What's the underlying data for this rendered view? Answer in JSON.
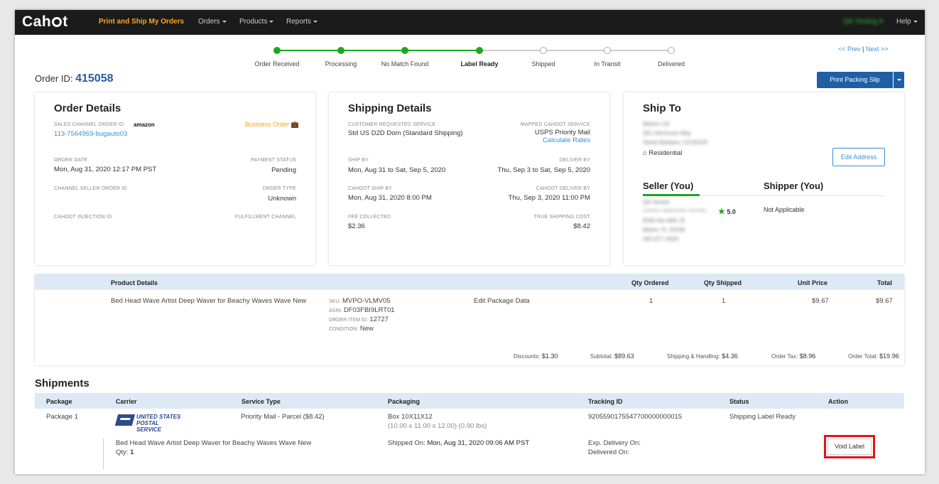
{
  "nav": {
    "logo": "Cahoot",
    "active_item": "Print and Ship My Orders",
    "items": [
      "Orders",
      "Products",
      "Reports"
    ],
    "user": "QA Testing",
    "help": "Help"
  },
  "progress": {
    "steps": [
      {
        "label": "Order Received",
        "done": true
      },
      {
        "label": "Processing",
        "done": true
      },
      {
        "label": "No Match Found",
        "done": true
      },
      {
        "label": "Label Ready",
        "done": true,
        "current": true
      },
      {
        "label": "Shipped",
        "done": false
      },
      {
        "label": "In Transit",
        "done": false
      },
      {
        "label": "Delivered",
        "done": false
      }
    ],
    "done_color": "#1ea620"
  },
  "pager": {
    "prev": "<< Prev",
    "sep": "|",
    "next": "Next >>"
  },
  "order": {
    "id_label": "Order ID:",
    "id": "415058"
  },
  "actions": {
    "print_packing_slip": "Print Packing Slip"
  },
  "order_details": {
    "title": "Order Details",
    "sales_channel_label": "SALES CHANNEL ORDER ID",
    "channel_logo": "amazon",
    "sales_channel_id": "113-7564959-bugauto03",
    "business_order": "Business Order",
    "order_date_label": "ORDER DATE",
    "order_date": "Mon, Aug 31, 2020 12:17 PM PST",
    "payment_status_label": "PAYMENT STATUS",
    "payment_status": "Pending",
    "channel_seller_label": "CHANNEL SELLER ORDER ID",
    "order_type_label": "ORDER TYPE",
    "order_type": "Unknown",
    "injection_label": "CAHOOT INJECTION ID",
    "fulfillment_label": "FULFILLMENT CHANNEL"
  },
  "shipping_details": {
    "title": "Shipping Details",
    "customer_service_label": "CUSTOMER REQUESTED SERVICE",
    "customer_service": "Std US D2D Dom (Standard Shipping)",
    "mapped_service_label": "MAPPED CAHOOT SERVICE",
    "mapped_service": "USPS Priority Mail",
    "calculate_rates": "Calculate Rates",
    "ship_by_label": "SHIP BY",
    "ship_by": "Mon, Aug 31 to Sat, Sep 5, 2020",
    "deliver_by_label": "DELIVER BY",
    "deliver_by": "Thu, Sep 3 to Sat, Sep 5, 2020",
    "cahoot_ship_by_label": "CAHOOT SHIP BY",
    "cahoot_ship_by": "Mon, Aug 31, 2020 8:00 PM",
    "cahoot_deliver_by_label": "CAHOOT DELIVER BY",
    "cahoot_deliver_by": "Thu, Sep 3, 2020 11:00 PM",
    "fee_label": "FEE COLLECTED",
    "fee": "$2.36",
    "true_cost_label": "TRUE SHIPPING COST",
    "true_cost": "$8.42"
  },
  "ship_to": {
    "title": "Ship To",
    "name": "Marlon US",
    "address1": "301 Hitchcock Way",
    "address2": "Santa Barbara, CA 93105",
    "type": "Residential",
    "edit_address": "Edit Address",
    "seller_tab": "Seller (You)",
    "shipper_tab": "Shipper (You)",
    "seller_name": "QA Vendor",
    "merchant_rating_label": "CAHOOT MERCHANT RATING",
    "rating": "5.0",
    "seller_addr1": "8340 Nw 66th St",
    "seller_addr2": "Miami, FL 33166",
    "seller_phone": "305-677-2929",
    "shipper_value": "Not Applicable"
  },
  "products": {
    "headers": {
      "details": "Product Details",
      "qty_ordered": "Qty Ordered",
      "qty_shipped": "Qty Shipped",
      "unit_price": "Unit Price",
      "total": "Total"
    },
    "row": {
      "name": "Bed Head Wave Artist Deep Waver for Beachy Waves Wave New",
      "sku_label": "SKU:",
      "sku": "MVPO-VLMV05",
      "asin_label": "ASIN:",
      "asin": "DF03FBI9LRT01",
      "item_id_label": "ORDER ITEM ID:",
      "item_id": "12727",
      "condition_label": "CONDITION:",
      "condition": "New",
      "edit_package": "Edit Package Data",
      "qty_ordered": "1",
      "qty_shipped": "1",
      "unit_price": "$9.67",
      "total": "$9.67"
    },
    "totals": {
      "discounts_label": "Discounts:",
      "discounts": "$1.30",
      "subtotal_label": "Subtotal:",
      "subtotal": "$89.63",
      "sh_label": "Shipping & Handling:",
      "sh": "$4.36",
      "tax_label": "Order Tax:",
      "tax": "$8.96",
      "total_label": "Order Total:",
      "total": "$19.96"
    }
  },
  "shipments": {
    "title": "Shipments",
    "headers": {
      "package": "Package",
      "carrier": "Carrier",
      "service": "Service Type",
      "packaging": "Packaging",
      "tracking": "Tracking ID",
      "status": "Status",
      "action": "Action"
    },
    "row": {
      "package": "Package 1",
      "carrier_line1": "UNITED STATES",
      "carrier_line2": "POSTAL SERVICE",
      "service": "Priority Mail - Parcel ($8.42)",
      "packaging": "Box 10X11X12",
      "dims": "(10.00 x 11.00 x 12.00) (0.90 lbs)",
      "tracking": "9205590175547700000000015",
      "status": "Shipping Label Ready",
      "item_name": "Bed Head Wave Artist Deep Waver for Beachy Waves Wave New",
      "qty_label": "Qty:",
      "qty": "1",
      "shipped_on_label": "Shipped On:",
      "shipped_on": "Mon, Aug 31, 2020 09:06 AM PST",
      "exp_delivery_label": "Exp. Delivery On:",
      "delivered_label": "Delivered On:",
      "void_label": "Void Label"
    }
  }
}
